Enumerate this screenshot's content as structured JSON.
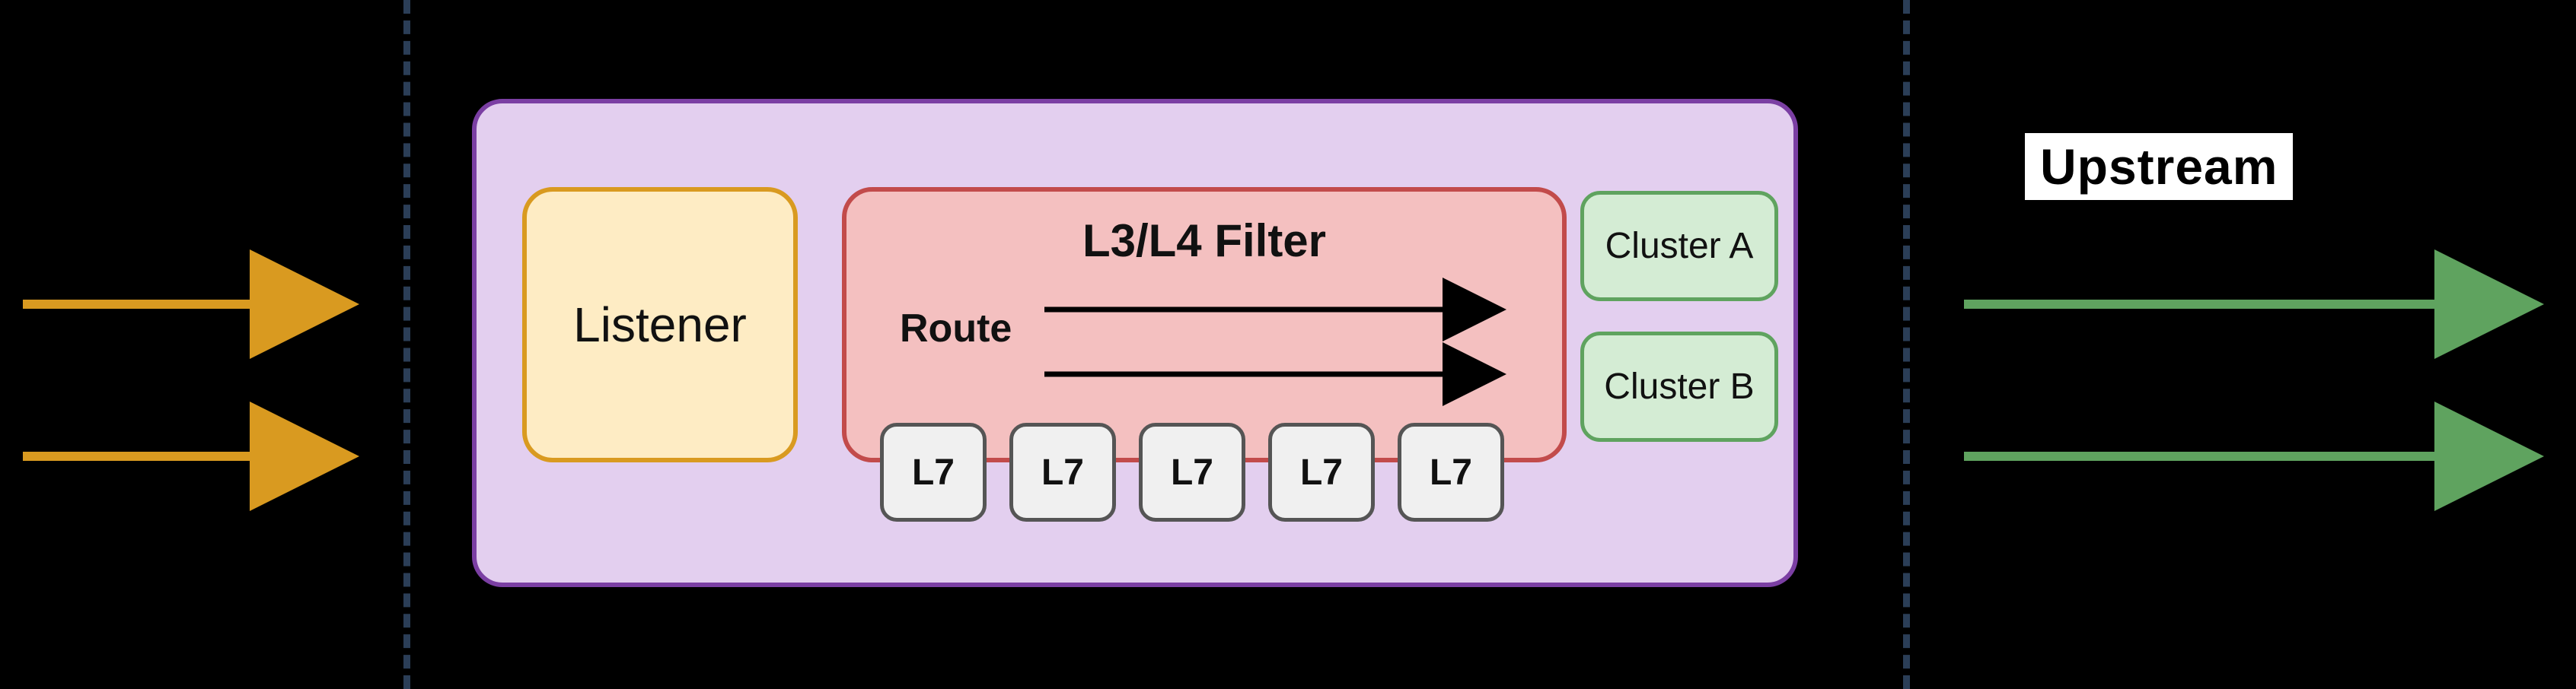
{
  "listener": {
    "label": "Listener"
  },
  "filter": {
    "title": "L3/L4 Filter",
    "route_label": "Route"
  },
  "l7_boxes": [
    "L7",
    "L7",
    "L7",
    "L7",
    "L7"
  ],
  "clusters": {
    "a": "Cluster A",
    "b": "Cluster B"
  },
  "upstream_label": "Upstream",
  "colors": {
    "dash": "#2b3e57",
    "inbound_arrow": "#d99a20",
    "outbound_arrow": "#5fa35f",
    "envoy_fill": "#e3cfef",
    "envoy_border": "#7b3fa3",
    "listener_fill": "#feecc4",
    "listener_border": "#d99a20",
    "filter_fill": "#f4c0c0",
    "filter_border": "#c24b4b",
    "l7_fill": "#f0f0f0",
    "l7_border": "#555555",
    "cluster_fill": "#d4ecd4",
    "cluster_border": "#5fa35f"
  }
}
